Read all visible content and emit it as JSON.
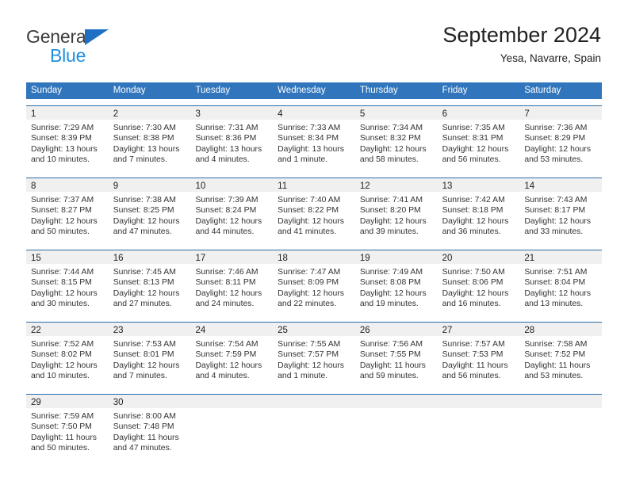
{
  "logo": {
    "word1": "General",
    "word2": "Blue",
    "triangle_color": "#1f6fc4",
    "word2_color": "#1f8fe0"
  },
  "header": {
    "title": "September 2024",
    "subtitle": "Yesa, Navarre, Spain"
  },
  "colors": {
    "header_blue": "#3176bc",
    "week_rule": "#2b6cab",
    "day_strip": "#f0f0f0"
  },
  "weekdays": [
    "Sunday",
    "Monday",
    "Tuesday",
    "Wednesday",
    "Thursday",
    "Friday",
    "Saturday"
  ],
  "weeks": [
    [
      {
        "day": "1",
        "sunrise": "Sunrise: 7:29 AM",
        "sunset": "Sunset: 8:39 PM",
        "daylight": "Daylight: 13 hours and 10 minutes."
      },
      {
        "day": "2",
        "sunrise": "Sunrise: 7:30 AM",
        "sunset": "Sunset: 8:38 PM",
        "daylight": "Daylight: 13 hours and 7 minutes."
      },
      {
        "day": "3",
        "sunrise": "Sunrise: 7:31 AM",
        "sunset": "Sunset: 8:36 PM",
        "daylight": "Daylight: 13 hours and 4 minutes."
      },
      {
        "day": "4",
        "sunrise": "Sunrise: 7:33 AM",
        "sunset": "Sunset: 8:34 PM",
        "daylight": "Daylight: 13 hours and 1 minute."
      },
      {
        "day": "5",
        "sunrise": "Sunrise: 7:34 AM",
        "sunset": "Sunset: 8:32 PM",
        "daylight": "Daylight: 12 hours and 58 minutes."
      },
      {
        "day": "6",
        "sunrise": "Sunrise: 7:35 AM",
        "sunset": "Sunset: 8:31 PM",
        "daylight": "Daylight: 12 hours and 56 minutes."
      },
      {
        "day": "7",
        "sunrise": "Sunrise: 7:36 AM",
        "sunset": "Sunset: 8:29 PM",
        "daylight": "Daylight: 12 hours and 53 minutes."
      }
    ],
    [
      {
        "day": "8",
        "sunrise": "Sunrise: 7:37 AM",
        "sunset": "Sunset: 8:27 PM",
        "daylight": "Daylight: 12 hours and 50 minutes."
      },
      {
        "day": "9",
        "sunrise": "Sunrise: 7:38 AM",
        "sunset": "Sunset: 8:25 PM",
        "daylight": "Daylight: 12 hours and 47 minutes."
      },
      {
        "day": "10",
        "sunrise": "Sunrise: 7:39 AM",
        "sunset": "Sunset: 8:24 PM",
        "daylight": "Daylight: 12 hours and 44 minutes."
      },
      {
        "day": "11",
        "sunrise": "Sunrise: 7:40 AM",
        "sunset": "Sunset: 8:22 PM",
        "daylight": "Daylight: 12 hours and 41 minutes."
      },
      {
        "day": "12",
        "sunrise": "Sunrise: 7:41 AM",
        "sunset": "Sunset: 8:20 PM",
        "daylight": "Daylight: 12 hours and 39 minutes."
      },
      {
        "day": "13",
        "sunrise": "Sunrise: 7:42 AM",
        "sunset": "Sunset: 8:18 PM",
        "daylight": "Daylight: 12 hours and 36 minutes."
      },
      {
        "day": "14",
        "sunrise": "Sunrise: 7:43 AM",
        "sunset": "Sunset: 8:17 PM",
        "daylight": "Daylight: 12 hours and 33 minutes."
      }
    ],
    [
      {
        "day": "15",
        "sunrise": "Sunrise: 7:44 AM",
        "sunset": "Sunset: 8:15 PM",
        "daylight": "Daylight: 12 hours and 30 minutes."
      },
      {
        "day": "16",
        "sunrise": "Sunrise: 7:45 AM",
        "sunset": "Sunset: 8:13 PM",
        "daylight": "Daylight: 12 hours and 27 minutes."
      },
      {
        "day": "17",
        "sunrise": "Sunrise: 7:46 AM",
        "sunset": "Sunset: 8:11 PM",
        "daylight": "Daylight: 12 hours and 24 minutes."
      },
      {
        "day": "18",
        "sunrise": "Sunrise: 7:47 AM",
        "sunset": "Sunset: 8:09 PM",
        "daylight": "Daylight: 12 hours and 22 minutes."
      },
      {
        "day": "19",
        "sunrise": "Sunrise: 7:49 AM",
        "sunset": "Sunset: 8:08 PM",
        "daylight": "Daylight: 12 hours and 19 minutes."
      },
      {
        "day": "20",
        "sunrise": "Sunrise: 7:50 AM",
        "sunset": "Sunset: 8:06 PM",
        "daylight": "Daylight: 12 hours and 16 minutes."
      },
      {
        "day": "21",
        "sunrise": "Sunrise: 7:51 AM",
        "sunset": "Sunset: 8:04 PM",
        "daylight": "Daylight: 12 hours and 13 minutes."
      }
    ],
    [
      {
        "day": "22",
        "sunrise": "Sunrise: 7:52 AM",
        "sunset": "Sunset: 8:02 PM",
        "daylight": "Daylight: 12 hours and 10 minutes."
      },
      {
        "day": "23",
        "sunrise": "Sunrise: 7:53 AM",
        "sunset": "Sunset: 8:01 PM",
        "daylight": "Daylight: 12 hours and 7 minutes."
      },
      {
        "day": "24",
        "sunrise": "Sunrise: 7:54 AM",
        "sunset": "Sunset: 7:59 PM",
        "daylight": "Daylight: 12 hours and 4 minutes."
      },
      {
        "day": "25",
        "sunrise": "Sunrise: 7:55 AM",
        "sunset": "Sunset: 7:57 PM",
        "daylight": "Daylight: 12 hours and 1 minute."
      },
      {
        "day": "26",
        "sunrise": "Sunrise: 7:56 AM",
        "sunset": "Sunset: 7:55 PM",
        "daylight": "Daylight: 11 hours and 59 minutes."
      },
      {
        "day": "27",
        "sunrise": "Sunrise: 7:57 AM",
        "sunset": "Sunset: 7:53 PM",
        "daylight": "Daylight: 11 hours and 56 minutes."
      },
      {
        "day": "28",
        "sunrise": "Sunrise: 7:58 AM",
        "sunset": "Sunset: 7:52 PM",
        "daylight": "Daylight: 11 hours and 53 minutes."
      }
    ],
    [
      {
        "day": "29",
        "sunrise": "Sunrise: 7:59 AM",
        "sunset": "Sunset: 7:50 PM",
        "daylight": "Daylight: 11 hours and 50 minutes."
      },
      {
        "day": "30",
        "sunrise": "Sunrise: 8:00 AM",
        "sunset": "Sunset: 7:48 PM",
        "daylight": "Daylight: 11 hours and 47 minutes."
      },
      {
        "day": "",
        "sunrise": "",
        "sunset": "",
        "daylight": ""
      },
      {
        "day": "",
        "sunrise": "",
        "sunset": "",
        "daylight": ""
      },
      {
        "day": "",
        "sunrise": "",
        "sunset": "",
        "daylight": ""
      },
      {
        "day": "",
        "sunrise": "",
        "sunset": "",
        "daylight": ""
      },
      {
        "day": "",
        "sunrise": "",
        "sunset": "",
        "daylight": ""
      }
    ]
  ]
}
